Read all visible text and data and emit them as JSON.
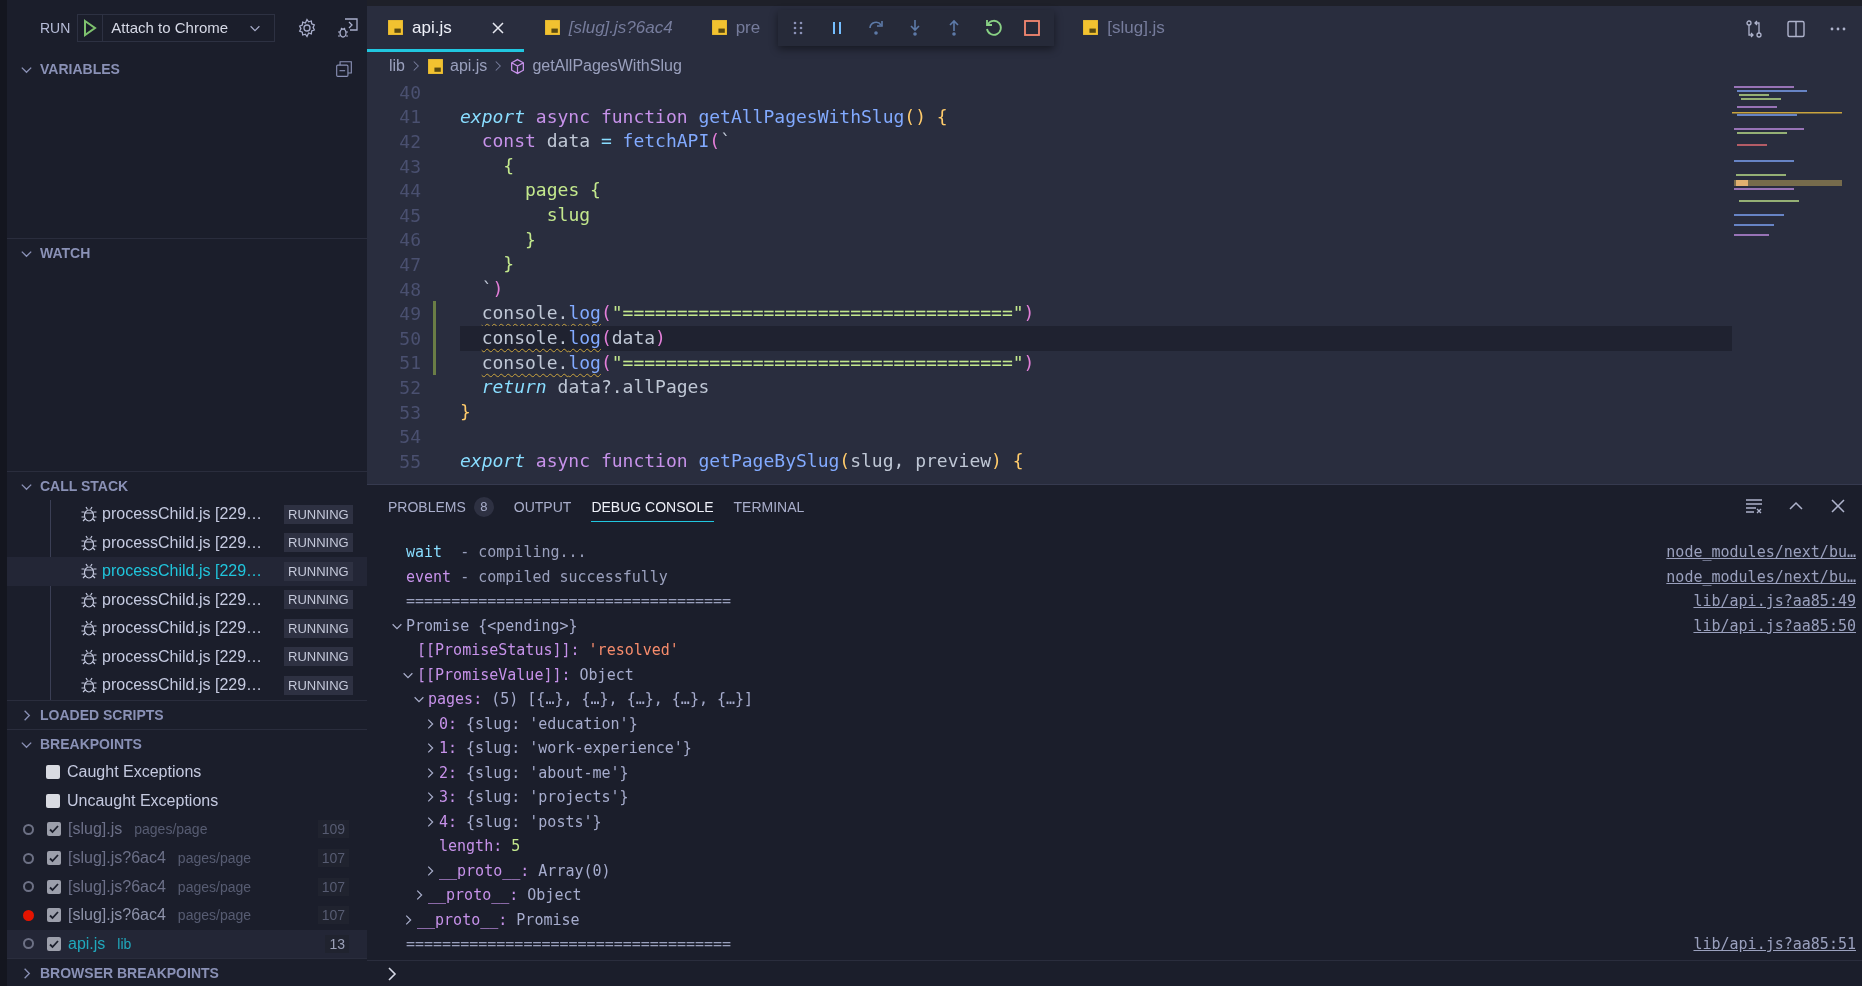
{
  "run_bar": {
    "label": "RUN",
    "configuration": "Attach to Chrome"
  },
  "variables": {
    "title": "VARIABLES",
    "expanded": true
  },
  "watch": {
    "title": "WATCH",
    "expanded": true
  },
  "call_stack": {
    "title": "CALL STACK",
    "expanded": true,
    "frames": [
      {
        "label": "processChild.js [229…",
        "status": "RUNNING",
        "selected": false
      },
      {
        "label": "processChild.js [229…",
        "status": "RUNNING",
        "selected": false
      },
      {
        "label": "processChild.js [229…",
        "status": "RUNNING",
        "selected": true
      },
      {
        "label": "processChild.js [229…",
        "status": "RUNNING",
        "selected": false
      },
      {
        "label": "processChild.js [229…",
        "status": "RUNNING",
        "selected": false
      },
      {
        "label": "processChild.js [229…",
        "status": "RUNNING",
        "selected": false
      },
      {
        "label": "processChild.js [229…",
        "status": "RUNNING",
        "selected": false
      }
    ]
  },
  "loaded_scripts": {
    "title": "LOADED SCRIPTS",
    "expanded": false
  },
  "breakpoints": {
    "title": "BREAKPOINTS",
    "expanded": true,
    "items": [
      {
        "kind": "exception",
        "label": "Caught Exceptions",
        "checked": false
      },
      {
        "kind": "exception",
        "label": "Uncaught Exceptions",
        "checked": false
      },
      {
        "kind": "file",
        "file": "[slug].js",
        "path": "pages/page",
        "line": "109",
        "checked": true,
        "verified": false,
        "selected": false
      },
      {
        "kind": "file",
        "file": "[slug].js?6ac4",
        "path": "pages/page",
        "line": "107",
        "checked": true,
        "verified": false,
        "selected": false
      },
      {
        "kind": "file",
        "file": "[slug].js?6ac4",
        "path": "pages/page",
        "line": "107",
        "checked": true,
        "verified": false,
        "selected": false
      },
      {
        "kind": "file",
        "file": "[slug].js?6ac4",
        "path": "pages/page",
        "line": "107",
        "checked": true,
        "verified": true,
        "selected": false
      },
      {
        "kind": "file",
        "file": "api.js",
        "path": "lib",
        "line": "13",
        "checked": true,
        "verified": false,
        "selected": true
      }
    ]
  },
  "browser_breakpoints": {
    "title": "BROWSER BREAKPOINTS",
    "expanded": false
  },
  "editor": {
    "tabs": [
      {
        "label": "api.js",
        "selected": true,
        "preview": false
      },
      {
        "label": "[slug].js?6ac4",
        "selected": false,
        "preview": true
      },
      {
        "label": "pre",
        "selected": false,
        "preview": false
      },
      {
        "label": "[slug].js",
        "selected": false,
        "preview": false
      }
    ],
    "breadcrumbs": [
      {
        "text": "lib",
        "kind": "folder"
      },
      {
        "text": "api.js",
        "kind": "file"
      },
      {
        "text": "getAllPagesWithSlug",
        "kind": "symbol"
      }
    ],
    "lines": [
      {
        "number": "40",
        "current": false,
        "modified": false
      },
      {
        "number": "41",
        "current": false,
        "modified": false,
        "tokens": [
          {
            "text": "export ",
            "kind": "keyword"
          },
          {
            "text": "async ",
            "kind": "storage"
          },
          {
            "text": "function ",
            "kind": "storage"
          },
          {
            "text": "getAllPagesWithSlug",
            "kind": "name"
          },
          {
            "text": "() {",
            "kind": "brace"
          }
        ]
      },
      {
        "number": "42",
        "current": false,
        "modified": false,
        "tokens": [
          {
            "text": "  const",
            "kind": "storage"
          },
          {
            "text": " data ",
            "kind": "plain"
          },
          {
            "text": "=",
            "kind": "operator"
          },
          {
            "text": " fetchAPI",
            "kind": "name"
          },
          {
            "text": "(",
            "kind": "paren"
          },
          {
            "text": "`",
            "kind": "plain"
          }
        ]
      },
      {
        "number": "43",
        "current": false,
        "modified": false,
        "tokens": [
          {
            "text": "    {",
            "kind": "string"
          }
        ]
      },
      {
        "number": "44",
        "current": false,
        "modified": false,
        "tokens": [
          {
            "text": "      pages {",
            "kind": "string"
          }
        ]
      },
      {
        "number": "45",
        "current": false,
        "modified": false,
        "tokens": [
          {
            "text": "        slug",
            "kind": "string"
          }
        ]
      },
      {
        "number": "46",
        "current": false,
        "modified": false,
        "tokens": [
          {
            "text": "      }",
            "kind": "string"
          }
        ]
      },
      {
        "number": "47",
        "current": false,
        "modified": false,
        "tokens": [
          {
            "text": "    }",
            "kind": "string"
          }
        ]
      },
      {
        "number": "48",
        "current": false,
        "modified": false,
        "tokens": [
          {
            "text": "  `",
            "kind": "plain"
          },
          {
            "text": ")",
            "kind": "paren"
          }
        ]
      },
      {
        "number": "49",
        "current": false,
        "modified": true,
        "tokens": [
          {
            "text": "  console.",
            "kind": "plain",
            "warning": true
          },
          {
            "text": "log",
            "kind": "name",
            "warning": true
          },
          {
            "text": "(",
            "kind": "paren"
          },
          {
            "text": "\"====================================\"",
            "kind": "string"
          },
          {
            "text": ")",
            "kind": "paren"
          }
        ]
      },
      {
        "number": "50",
        "current": true,
        "modified": true,
        "tokens": [
          {
            "text": "  console.",
            "kind": "plain",
            "warning": true
          },
          {
            "text": "log",
            "kind": "name",
            "warning": true
          },
          {
            "text": "(",
            "kind": "paren"
          },
          {
            "text": "data",
            "kind": "plain"
          },
          {
            "text": ")",
            "kind": "paren"
          }
        ]
      },
      {
        "number": "51",
        "current": false,
        "modified": true,
        "tokens": [
          {
            "text": "  console.",
            "kind": "plain",
            "warning": true
          },
          {
            "text": "log",
            "kind": "name",
            "warning": true
          },
          {
            "text": "(",
            "kind": "paren"
          },
          {
            "text": "\"====================================\"",
            "kind": "string"
          },
          {
            "text": ")",
            "kind": "paren"
          }
        ]
      },
      {
        "number": "52",
        "current": false,
        "modified": false,
        "tokens": [
          {
            "text": "  return",
            "kind": "keyword"
          },
          {
            "text": " data?.allPages",
            "kind": "plain"
          }
        ]
      },
      {
        "number": "53",
        "current": false,
        "modified": false,
        "tokens": [
          {
            "text": "}",
            "kind": "brace"
          }
        ]
      },
      {
        "number": "54",
        "current": false,
        "modified": false
      },
      {
        "number": "55",
        "current": false,
        "modified": false,
        "tokens": [
          {
            "text": "export ",
            "kind": "keyword"
          },
          {
            "text": "async ",
            "kind": "storage"
          },
          {
            "text": "function ",
            "kind": "storage"
          },
          {
            "text": "getPageBySlug",
            "kind": "name"
          },
          {
            "text": "(",
            "kind": "brace"
          },
          {
            "text": "slug, preview",
            "kind": "plain"
          },
          {
            "text": ") {",
            "kind": "brace"
          }
        ]
      }
    ]
  },
  "panel": {
    "tabs": [
      {
        "label": "PROBLEMS",
        "badge": "8",
        "selected": false
      },
      {
        "label": "OUTPUT",
        "selected": false
      },
      {
        "label": "DEBUG CONSOLE",
        "selected": true
      },
      {
        "label": "TERMINAL",
        "selected": false
      }
    ],
    "console": [
      {
        "kind": "log",
        "label": "wait",
        "color": "#89ddff",
        "text": "  - compiling...",
        "source": "node_modules/next/bu…"
      },
      {
        "kind": "log",
        "label": "event",
        "color": "#c792ea",
        "text": " - compiled successfully",
        "source": "node_modules/next/bu…"
      },
      {
        "kind": "plain",
        "text": "====================================",
        "source": "lib/api.js?aa85:49"
      },
      {
        "kind": "tree",
        "source": "lib/api.js?aa85:50",
        "node": {
          "kind": "branch",
          "expanded": true,
          "value": "Promise {<pending>}",
          "color": "#a6accd",
          "children": [
            {
              "kind": "leaf",
              "key": "[[PromiseStatus]]:",
              "value": "'resolved'",
              "color": "#f78c6c"
            },
            {
              "kind": "branch",
              "expanded": true,
              "key": "[[PromiseValue]]:",
              "value": "Object",
              "color": "#a6accd",
              "children": [
                {
                  "kind": "branch",
                  "expanded": true,
                  "key": "pages:",
                  "value": "(5) [{…}, {…}, {…}, {…}, {…}]",
                  "color": "#a6accd",
                  "children": [
                    {
                      "kind": "branch",
                      "expanded": false,
                      "key": "0:",
                      "value": "{slug: 'education'}",
                      "color": "#a6accd"
                    },
                    {
                      "kind": "branch",
                      "expanded": false,
                      "key": "1:",
                      "value": "{slug: 'work-experience'}",
                      "color": "#a6accd"
                    },
                    {
                      "kind": "branch",
                      "expanded": false,
                      "key": "2:",
                      "value": "{slug: 'about-me'}",
                      "color": "#a6accd"
                    },
                    {
                      "kind": "branch",
                      "expanded": false,
                      "key": "3:",
                      "value": "{slug: 'projects'}",
                      "color": "#a6accd"
                    },
                    {
                      "kind": "branch",
                      "expanded": false,
                      "key": "4:",
                      "value": "{slug: 'posts'}",
                      "color": "#a6accd"
                    },
                    {
                      "kind": "leaf",
                      "key": "length:",
                      "value": "5",
                      "color": "#c3e88d"
                    },
                    {
                      "kind": "branch",
                      "expanded": false,
                      "key": "__proto__:",
                      "value": "Array(0)",
                      "color": "#a6accd"
                    }
                  ]
                },
                {
                  "kind": "branch",
                  "expanded": false,
                  "key": "__proto__:",
                  "value": "Object",
                  "color": "#a6accd"
                }
              ]
            },
            {
              "kind": "branch",
              "expanded": false,
              "key": "__proto__:",
              "value": "Promise",
              "color": "#a6accd"
            }
          ]
        }
      },
      {
        "kind": "plain",
        "text": "====================================",
        "source": "lib/api.js?aa85:51"
      }
    ]
  }
}
